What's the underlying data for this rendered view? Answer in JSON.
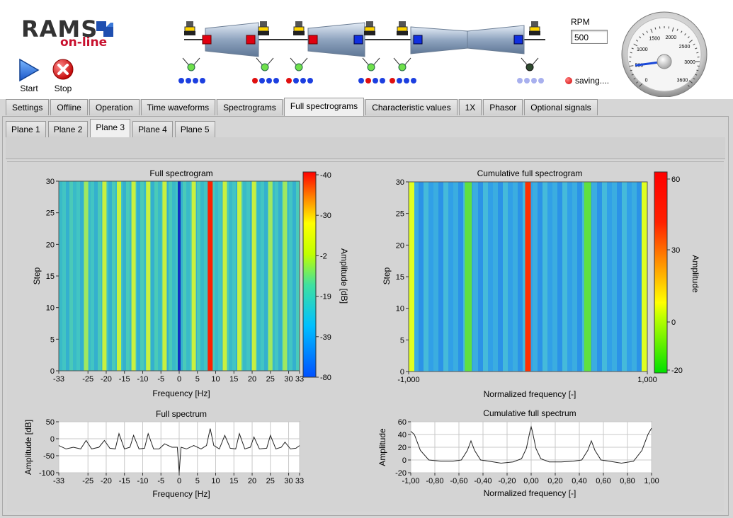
{
  "logo": {
    "brand": "RAMS",
    "tagline": "on-line"
  },
  "controls": {
    "start_label": "Start",
    "stop_label": "Stop"
  },
  "rpm": {
    "label": "RPM",
    "value": "500"
  },
  "status": {
    "saving_text": "saving...."
  },
  "gauge": {
    "ticks": [
      "0",
      "500",
      "1000",
      "1500",
      "2000",
      "2500",
      "3000",
      "3600"
    ],
    "value": 500,
    "max": 3600
  },
  "tabs": [
    "Settings",
    "Offline",
    "Operation",
    "Time waveforms",
    "Spectrograms",
    "Full spectrograms",
    "Characteristic values",
    "1X",
    "Phasor",
    "Optional signals"
  ],
  "active_tab": "Full spectrograms",
  "subtabs": [
    "Plane 1",
    "Plane 2",
    "Plane 3",
    "Plane 4",
    "Plane 5"
  ],
  "active_subtab": "Plane 3",
  "chart_data": [
    {
      "type": "heatmap",
      "title": "Full spectrogram",
      "xlabel": "Frequency [Hz]",
      "ylabel": "Step",
      "x_ticks": [
        "-33",
        "-25",
        "-20",
        "-15",
        "-10",
        "-5",
        "0",
        "5",
        "10",
        "15",
        "20",
        "25",
        "30",
        "33"
      ],
      "y_ticks": [
        "0",
        "5",
        "10",
        "15",
        "20",
        "25",
        "30"
      ],
      "xlim": [
        -33,
        33
      ],
      "ylim": [
        0,
        30
      ],
      "colorbar": {
        "label": "Amplitude [dB]",
        "ticks": [
          "-40",
          "-30",
          "-2",
          "-19",
          "-39",
          "-80"
        ]
      },
      "peaks_hz": [
        -25.5,
        -20.5,
        -16.5,
        -12.5,
        -8.5,
        -4,
        0,
        4,
        8.5,
        12.5,
        16.5,
        20.5,
        25,
        29
      ]
    },
    {
      "type": "heatmap",
      "title": "Cumulative full spectrogram",
      "xlabel": "Normalized frequency [-]",
      "ylabel": "Step",
      "x_ticks": [
        "-1,000",
        "1,000"
      ],
      "y_ticks": [
        "0",
        "5",
        "10",
        "15",
        "20",
        "25",
        "30"
      ],
      "xlim": [
        -1,
        1
      ],
      "ylim": [
        0,
        30
      ],
      "colorbar": {
        "label": "Amplitude",
        "ticks": [
          "60",
          "30",
          "0",
          "-20"
        ]
      },
      "peaks": [
        -1,
        -0.5,
        0,
        0.5,
        1
      ]
    },
    {
      "type": "line",
      "title": "Full spectrum",
      "xlabel": "Frequency [Hz]",
      "ylabel": "Amplitude [dB]",
      "x_ticks": [
        "-33",
        "-25",
        "-20",
        "-15",
        "-10",
        "-5",
        "0",
        "5",
        "10",
        "15",
        "20",
        "25",
        "30",
        "33"
      ],
      "y_ticks": [
        "50",
        "0",
        "-50",
        "-100"
      ],
      "xlim": [
        -33,
        33
      ],
      "ylim": [
        -100,
        50
      ],
      "series": [
        {
          "x": [
            -33,
            -31,
            -29,
            -27,
            -25.5,
            -24,
            -22,
            -20.5,
            -19,
            -17.5,
            -16.5,
            -15,
            -13.5,
            -12.5,
            -11,
            -9.5,
            -8.5,
            -7,
            -5.5,
            -4,
            -2,
            -0.5,
            0,
            0.5,
            2,
            4,
            6,
            7.5,
            8.5,
            9.5,
            11,
            12.5,
            14,
            15.5,
            16.5,
            18,
            19.5,
            20.5,
            22,
            24,
            25,
            26.5,
            28,
            29,
            30.5,
            32,
            33
          ],
          "y": [
            -20,
            -30,
            -25,
            -30,
            -5,
            -30,
            -25,
            -5,
            -28,
            -30,
            15,
            -30,
            -25,
            10,
            -30,
            -28,
            15,
            -30,
            -30,
            -15,
            -25,
            -25,
            -100,
            -25,
            -30,
            -20,
            -30,
            -20,
            30,
            -20,
            -30,
            10,
            -28,
            -30,
            15,
            -30,
            -25,
            5,
            -30,
            -28,
            10,
            -30,
            -25,
            -10,
            -30,
            -28,
            -20
          ]
        }
      ]
    },
    {
      "type": "line",
      "title": "Cumulative full spectrum",
      "xlabel": "Normalized frequency [-]",
      "ylabel": "Amplitude",
      "x_ticks": [
        "-1,00",
        "-0,80",
        "-0,60",
        "-0,40",
        "-0,20",
        "0,00",
        "0,20",
        "0,40",
        "0,60",
        "0,80",
        "1,00"
      ],
      "y_ticks": [
        "60",
        "40",
        "20",
        "0",
        "-20"
      ],
      "xlim": [
        -1,
        1
      ],
      "ylim": [
        -20,
        60
      ],
      "series": [
        {
          "x": [
            -1,
            -0.97,
            -0.92,
            -0.85,
            -0.75,
            -0.65,
            -0.58,
            -0.53,
            -0.5,
            -0.47,
            -0.42,
            -0.35,
            -0.25,
            -0.15,
            -0.08,
            -0.04,
            -0.01,
            0,
            0.01,
            0.04,
            0.08,
            0.15,
            0.25,
            0.35,
            0.42,
            0.47,
            0.5,
            0.53,
            0.58,
            0.65,
            0.75,
            0.85,
            0.92,
            0.97,
            1
          ],
          "y": [
            45,
            40,
            15,
            0,
            -2,
            -2,
            0,
            15,
            30,
            15,
            0,
            -2,
            -5,
            -3,
            2,
            18,
            45,
            52,
            45,
            18,
            2,
            -3,
            -3,
            -2,
            0,
            15,
            30,
            15,
            0,
            -2,
            -5,
            -2,
            15,
            40,
            50
          ]
        }
      ]
    }
  ]
}
